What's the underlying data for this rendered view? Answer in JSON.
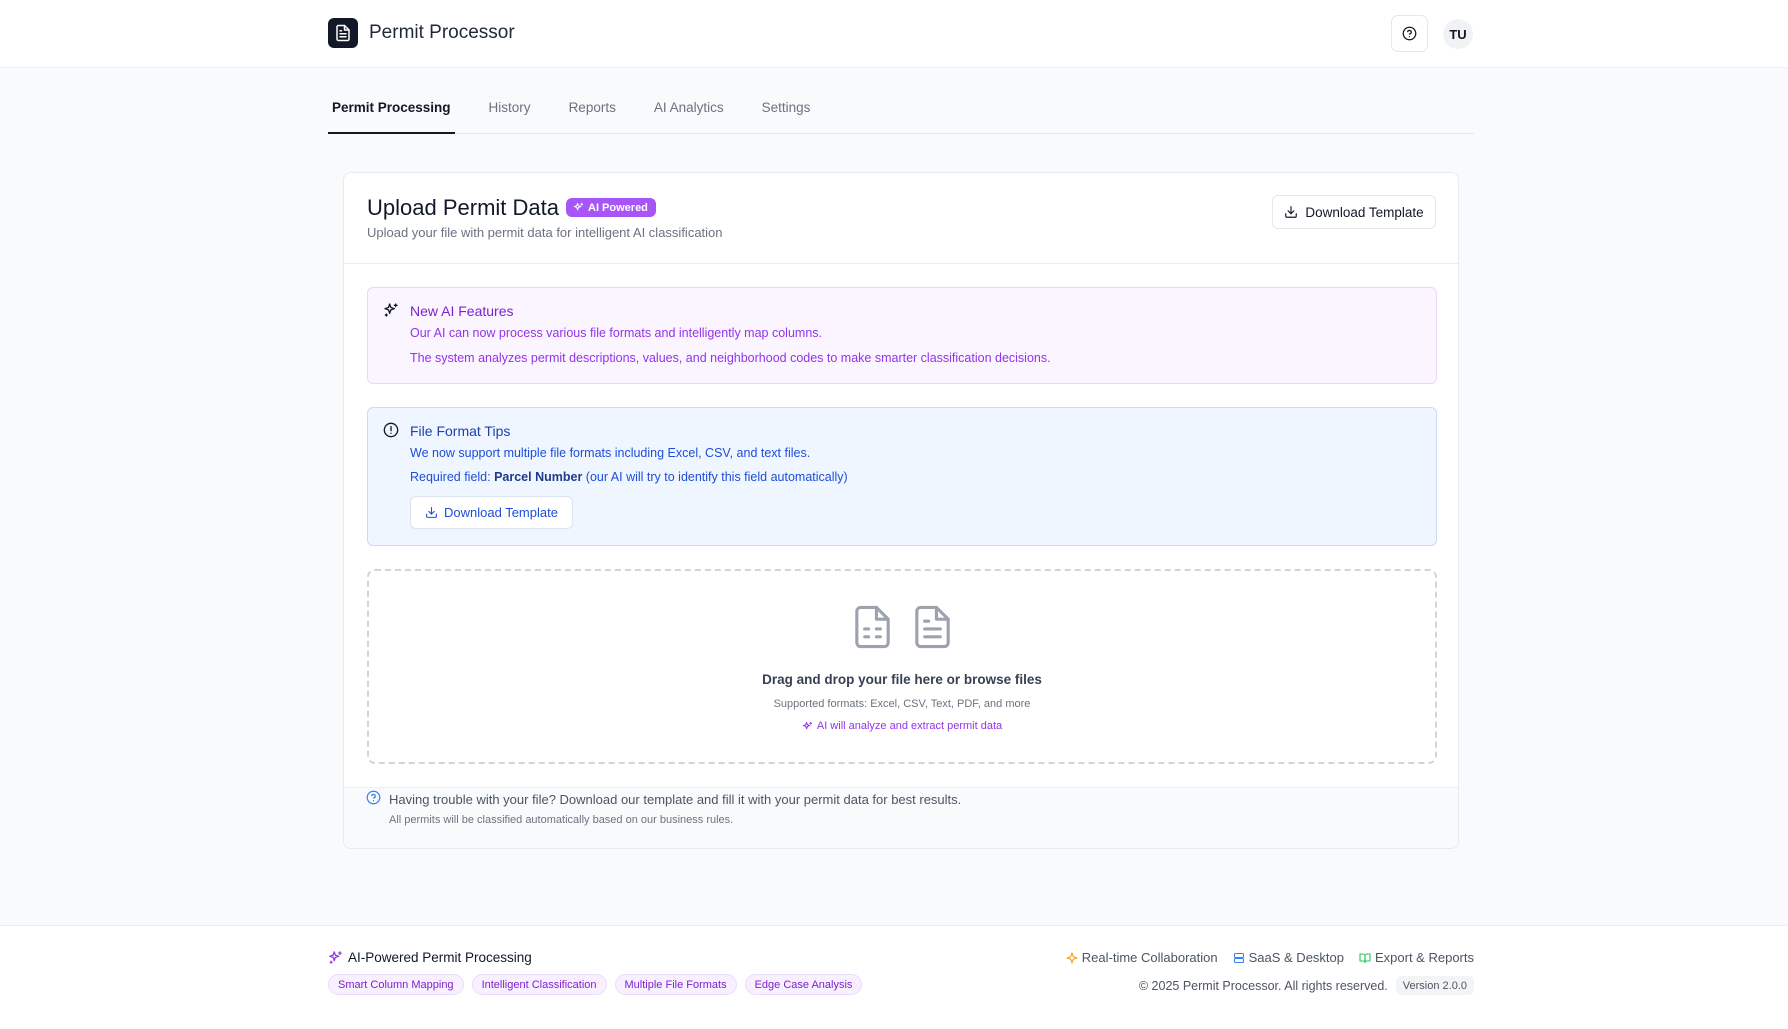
{
  "header": {
    "app_name": "Permit Processor",
    "avatar_initials": "TU"
  },
  "tabs": [
    {
      "label": "Permit Processing",
      "active": true
    },
    {
      "label": "History",
      "active": false
    },
    {
      "label": "Reports",
      "active": false
    },
    {
      "label": "AI Analytics",
      "active": false
    },
    {
      "label": "Settings",
      "active": false
    }
  ],
  "upload": {
    "title": "Upload Permit Data",
    "badge": "AI Powered",
    "subtitle": "Upload your file with permit data for intelligent AI classification",
    "download_label": "Download Template"
  },
  "ai_features": {
    "heading": "New AI Features",
    "line1": "Our AI can now process various file formats and intelligently map columns.",
    "line2": "The system analyzes permit descriptions, values, and neighborhood codes to make smarter classification decisions."
  },
  "tips": {
    "heading": "File Format Tips",
    "line1": "We now support multiple file formats including Excel, CSV, and text files.",
    "required_prefix": "Required field: ",
    "required_field": "Parcel Number",
    "required_suffix": " (our AI will try to identify this field automatically)",
    "download_label": "Download Template"
  },
  "dropzone": {
    "main_text": "Drag and drop your file here or browse files",
    "formats_text": "Supported formats: Excel, CSV, Text, PDF, and more",
    "ai_text": "AI will analyze and extract permit data"
  },
  "help": {
    "line1": "Having trouble with your file? Download our template and fill it with your permit data for best results.",
    "line2": "All permits will be classified automatically based on our business rules."
  },
  "footer": {
    "title": "AI-Powered Permit Processing",
    "chips": [
      "Smart Column Mapping",
      "Intelligent Classification",
      "Multiple File Formats",
      "Edge Case Analysis"
    ],
    "links": [
      "Real-time Collaboration",
      "SaaS & Desktop",
      "Export & Reports"
    ],
    "copyright": "© 2025 Permit Processor. All rights reserved.",
    "version": "Version 2.0.0"
  },
  "colors": {
    "accent_purple": "#a855f7",
    "info_blue": "#1d4ed8",
    "dark": "#111827"
  }
}
